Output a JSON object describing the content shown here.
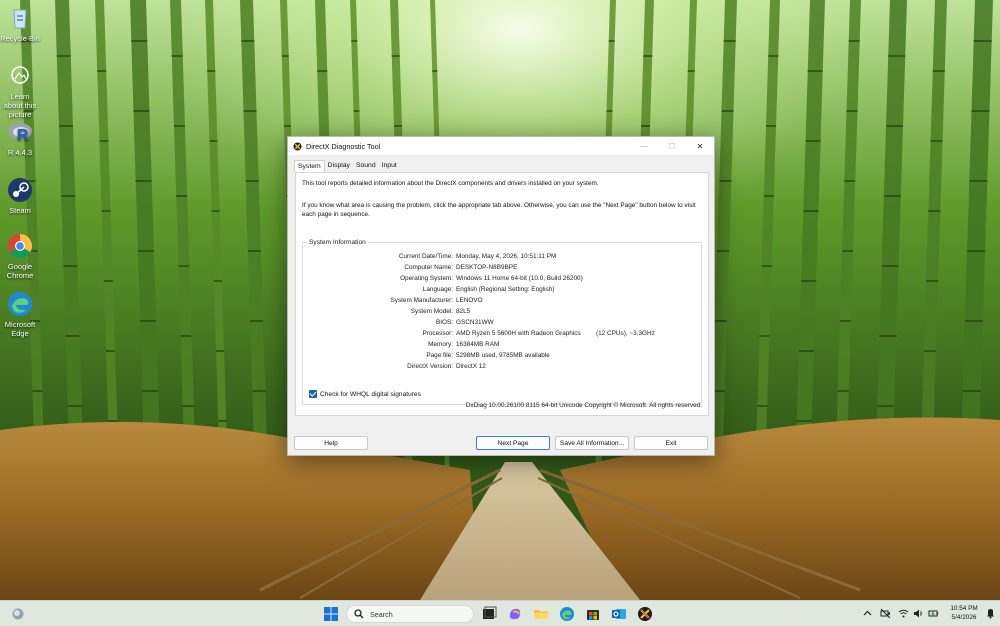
{
  "desktop": {
    "icons": [
      {
        "label": "Recycle Bin",
        "icon": "recycle-bin-icon"
      },
      {
        "label": "Learn about this picture",
        "icon": "learn-about-picture-icon"
      },
      {
        "label": "R 4.4.3",
        "icon": "r-language-icon"
      },
      {
        "label": "Steam",
        "icon": "steam-icon"
      },
      {
        "label": "Google Chrome",
        "icon": "chrome-icon"
      },
      {
        "label": "Microsoft Edge",
        "icon": "edge-icon"
      }
    ]
  },
  "dialog": {
    "title": "DirectX Diagnostic Tool",
    "tabs": [
      {
        "label": "System",
        "active": true
      },
      {
        "label": "Display",
        "active": false
      },
      {
        "label": "Sound",
        "active": false
      },
      {
        "label": "Input",
        "active": false
      }
    ],
    "intro_line1": "This tool reports detailed information about the DirectX components and drivers installed on your system.",
    "intro_line2": "If you know what area is causing the problem, click the appropriate tab above.  Otherwise, you can use the \"Next Page\" button below to visit each page in sequence.",
    "group_title": "System Information",
    "system_info": [
      {
        "label": "Current Date/Time:",
        "value": "Monday, May 4, 2026, 10:51:11 PM"
      },
      {
        "label": "Computer Name:",
        "value": "DESKTOP-N8B9BPE"
      },
      {
        "label": "Operating System:",
        "value": "Windows 11 Home 64-bit (10.0, Build 26200)"
      },
      {
        "label": "Language:",
        "value": "English (Regional Setting: English)"
      },
      {
        "label": "System Manufacturer:",
        "value": "LENOVO"
      },
      {
        "label": "System Model:",
        "value": "82L5"
      },
      {
        "label": "BIOS:",
        "value": "GSCN31WW"
      },
      {
        "label": "Processor:",
        "value": "AMD Ryzen 5 5600H with Radeon Graphics",
        "value_extra": "(12 CPUs), ~3.3GHz"
      },
      {
        "label": "Memory:",
        "value": "16384MB RAM"
      },
      {
        "label": "Page file:",
        "value": "5298MB used, 9785MB available"
      },
      {
        "label": "DirectX Version:",
        "value": "DirectX 12"
      }
    ],
    "whql_label": "Check for WHQL digital signatures",
    "whql_checked": true,
    "footer_text": "DxDiag 10.00.26100.8115 64-bit Unicode  Copyright © Microsoft. All rights reserved.",
    "buttons": {
      "help": "Help",
      "next_page": "Next Page",
      "save_all": "Save All Information...",
      "exit": "Exit"
    },
    "window_controls": {
      "minimize": "—",
      "maximize": "☐",
      "close": "✕"
    }
  },
  "taskbar": {
    "search_placeholder": "Search",
    "apps": [
      "start-icon",
      "task-view-icon",
      "copilot-icon",
      "file-explorer-icon",
      "edge-icon",
      "microsoft-store-icon",
      "outlook-icon",
      "directx-icon"
    ],
    "clock_time": "10:54 PM",
    "clock_date": "5/4/2026",
    "accent_color": "#1f5fb8"
  }
}
